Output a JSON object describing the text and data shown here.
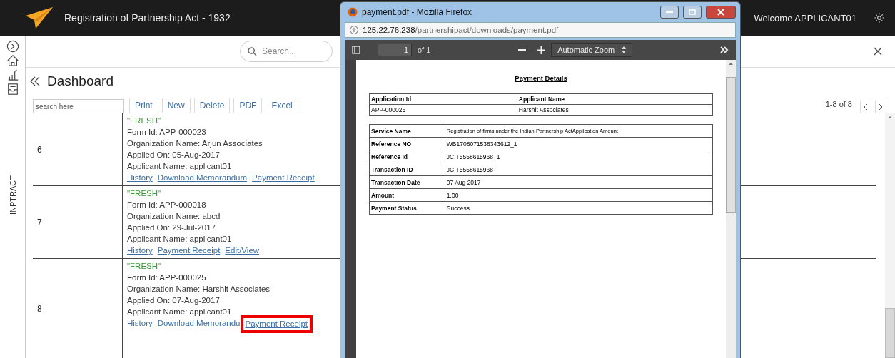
{
  "app": {
    "title": "Registration of Partnership Act - 1932",
    "welcome": "Welcome APPLICANT01",
    "rail_label": "INPTRACT"
  },
  "search": {
    "placeholder": "Search..."
  },
  "page_title": "Dashboard",
  "toolbar": {
    "filter_placeholder": "search here",
    "buttons": [
      "Print",
      "New",
      "Delete",
      "PDF",
      "Excel"
    ],
    "pager": "1-8 of 8"
  },
  "rows": [
    {
      "number": "6",
      "status": "\"FRESH\"",
      "lines": [
        "Form Id: APP-000023",
        "Organization Name: Arjun Associates",
        "Applied On: 05-Aug-2017",
        "Applicant Name: applicant01"
      ],
      "links": [
        {
          "label": "History",
          "highlighted": false
        },
        {
          "label": "Download Memorandum",
          "highlighted": false
        },
        {
          "label": "Payment Receipt",
          "highlighted": false
        }
      ]
    },
    {
      "number": "7",
      "status": "\"FRESH\"",
      "lines": [
        "Form Id: APP-000018",
        "Organization Name: abcd",
        "Applied On: 29-Jul-2017",
        "Applicant Name: applicant01"
      ],
      "links": [
        {
          "label": "History",
          "highlighted": false
        },
        {
          "label": "Payment Receipt",
          "highlighted": false
        },
        {
          "label": "Edit/View",
          "highlighted": false
        }
      ]
    },
    {
      "number": "8",
      "status": "\"FRESH\"",
      "lines": [
        "Form Id: APP-000025",
        "Organization Name: Harshit Associates",
        "Applied On: 07-Aug-2017",
        "Applicant Name: applicant01"
      ],
      "links": [
        {
          "label": "History",
          "highlighted": false
        },
        {
          "label": "Download Memorandu",
          "highlighted": false
        },
        {
          "label": "Payment Receipt",
          "highlighted": true
        }
      ]
    }
  ],
  "browser": {
    "title": "payment.pdf - Mozilla Firefox",
    "url_host": "125.22.76.238",
    "url_path": "/partnershipact/downloads/payment.pdf",
    "page_number": "1",
    "page_count": "of 1",
    "zoom": "Automatic Zoom",
    "document": {
      "heading": "Payment Details",
      "summary": {
        "columns": [
          "Application Id",
          "Applicant Name"
        ],
        "values": [
          "APP-000025",
          "Harshit Associates"
        ]
      },
      "details": [
        {
          "label": "Service Name",
          "value": "Registration of firms under the Indian Partnership ActApplication Amount"
        },
        {
          "label": "Reference NO",
          "value": "WB1708071538343612_1"
        },
        {
          "label": "Reference Id",
          "value": "JCIT5558615968_1"
        },
        {
          "label": "Transaction ID",
          "value": "JCIT5558615968"
        },
        {
          "label": "Transaction Date",
          "value": "07 Aug 2017"
        },
        {
          "label": "Amount",
          "value": "1.00"
        },
        {
          "label": "Payment Status",
          "value": "Success"
        }
      ]
    }
  }
}
